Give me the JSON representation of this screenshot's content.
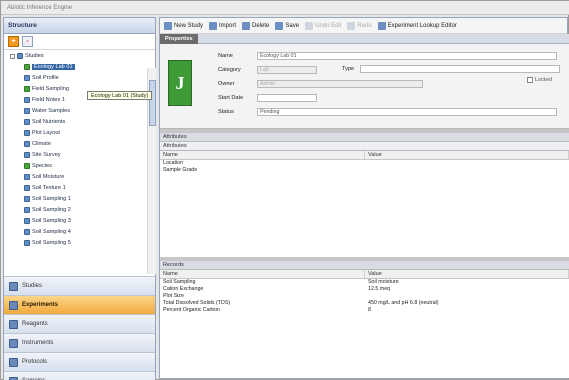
{
  "window": {
    "title": "Abiotic Inference Engine"
  },
  "left_panel": {
    "header": "Structure",
    "tools": [
      "+",
      "-"
    ],
    "tree": [
      {
        "label": "Studies",
        "level": 0,
        "expander": "-"
      },
      {
        "label": "Ecology Lab 01",
        "level": 1,
        "selected": true,
        "green": true
      },
      {
        "label": "Soil Profile",
        "level": 1
      },
      {
        "label": "Field Sampling",
        "level": 1,
        "green": true
      },
      {
        "label": "Field Notes 1",
        "level": 1
      },
      {
        "label": "Water Samples",
        "level": 1
      },
      {
        "label": "Soil Nutrients",
        "level": 1
      },
      {
        "label": "Plot Layout",
        "level": 1
      },
      {
        "label": "Climate",
        "level": 1
      },
      {
        "label": "Site Survey",
        "level": 1
      },
      {
        "label": "Species",
        "level": 1,
        "green": true
      },
      {
        "label": "Soil Moisture",
        "level": 1
      },
      {
        "label": "Soil Texture 1",
        "level": 1
      },
      {
        "label": "Soil Sampling 1",
        "level": 1
      },
      {
        "label": "Soil Sampling 2",
        "level": 1
      },
      {
        "label": "Soil Sampling 3",
        "level": 1
      },
      {
        "label": "Soil Sampling 4",
        "level": 1
      },
      {
        "label": "Soil Sampling 5",
        "level": 1
      }
    ],
    "tooltip": "Ecology Lab 01 (Study)",
    "nav": [
      {
        "label": "Studies",
        "active": false
      },
      {
        "label": "Experiments",
        "active": true
      },
      {
        "label": "Reagents",
        "active": false
      },
      {
        "label": "Instruments",
        "active": false
      },
      {
        "label": "Protocols",
        "active": false
      },
      {
        "label": "Samples",
        "active": false
      }
    ]
  },
  "toolbar": {
    "items": [
      {
        "label": "New Study",
        "disabled": false
      },
      {
        "label": "Import",
        "disabled": false
      },
      {
        "label": "Delete",
        "disabled": false
      },
      {
        "label": "Save",
        "disabled": false
      },
      {
        "label": "Undo Edit",
        "disabled": true
      },
      {
        "label": "Redo",
        "disabled": true
      },
      {
        "label": "Experiment Lookup Editor",
        "disabled": false
      }
    ]
  },
  "properties": {
    "tab": "Properties",
    "icon_letter": "J",
    "fields": [
      {
        "label": "Name",
        "value": "Ecology Lab 01",
        "disabled": false,
        "width": 300
      },
      {
        "label": "Category",
        "value": "Lab",
        "disabled": true,
        "width": 60
      },
      {
        "label": "Owner",
        "value": "Admin",
        "disabled": true,
        "width": 166
      },
      {
        "label": "Start Date",
        "value": "",
        "disabled": false,
        "width": 60
      },
      {
        "label": "Status",
        "value": "Pending",
        "disabled": false,
        "width": 300
      }
    ],
    "type_label": "Type",
    "type_value": "",
    "checkbox_label": "Locked"
  },
  "attributes": {
    "title": "Attributes",
    "subtitle": "Attributes",
    "columns": [
      "Name",
      "Value"
    ],
    "rows": [
      [
        "Location",
        ""
      ],
      [
        "Sample Grade",
        ""
      ]
    ]
  },
  "records": {
    "title": "Records",
    "columns": [
      "Name",
      "Value"
    ],
    "rows": [
      [
        "Soil Sampling",
        "Soil moisture"
      ],
      [
        "Cation Exchange",
        "12.5 meq"
      ],
      [
        "Plot Size",
        ""
      ],
      [
        "Total Dissolved Solids (TDS)",
        "450 mg/L and pH 6.8 (neutral)"
      ],
      [
        "Percent Organic Carbon",
        "8"
      ]
    ]
  }
}
